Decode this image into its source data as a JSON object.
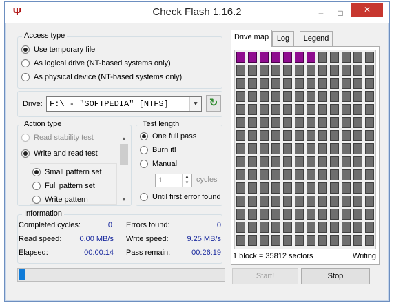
{
  "window": {
    "title": "Check Flash 1.16.2",
    "icon": "usb-plug-icon",
    "controls": {
      "minimize": "–",
      "maximize": "□",
      "close": "✕"
    }
  },
  "access_type": {
    "title": "Access type",
    "options": [
      {
        "label": "Use temporary file",
        "checked": true
      },
      {
        "label": "As logical drive (NT-based systems only)",
        "checked": false
      },
      {
        "label": "As physical device (NT-based systems only)",
        "checked": false
      }
    ]
  },
  "drive": {
    "label": "Drive:",
    "value": "F:\\ - \"SOFTPEDIA\" [NTFS]"
  },
  "action_type": {
    "title": "Action type",
    "options": [
      {
        "label": "Read stability test",
        "checked": false,
        "enabled": false
      },
      {
        "label": "Write and read test",
        "checked": true,
        "enabled": true
      }
    ],
    "sub_options": [
      {
        "label": "Small pattern set",
        "checked": true
      },
      {
        "label": "Full pattern set",
        "checked": false
      },
      {
        "label": "Write pattern",
        "checked": false
      }
    ]
  },
  "test_length": {
    "title": "Test length",
    "options": [
      {
        "label": "One full pass",
        "checked": true
      },
      {
        "label": "Burn it!",
        "checked": false
      },
      {
        "label": "Manual",
        "checked": false
      },
      {
        "label": "Until first error found",
        "checked": false
      }
    ],
    "cycles_value": "1",
    "cycles_label": "cycles"
  },
  "information": {
    "title": "Information",
    "completed_cycles_label": "Completed cycles:",
    "completed_cycles": "0",
    "errors_found_label": "Errors found:",
    "errors_found": "0",
    "read_speed_label": "Read speed:",
    "read_speed": "0.00 MB/s",
    "write_speed_label": "Write speed:",
    "write_speed": "9.25 MB/s",
    "elapsed_label": "Elapsed:",
    "elapsed": "00:00:14",
    "pass_remain_label": "Pass remain:",
    "pass_remain": "00:26:19"
  },
  "progress": {
    "fraction": 0.03
  },
  "tabs": [
    {
      "label": "Drive map",
      "active": true
    },
    {
      "label": "Log",
      "active": false
    },
    {
      "label": "Legend",
      "active": false
    }
  ],
  "drive_map": {
    "columns": 12,
    "rows": 15,
    "used_blocks": 7,
    "used_color": "#8e0c8e",
    "free_color": "#6e6e6e",
    "block_info": "1 block = 35812 sectors",
    "status": "Writing"
  },
  "buttons": {
    "start": "Start!",
    "stop": "Stop"
  },
  "colors": {
    "value_text": "#1a2a9e",
    "progress": "#0f7bd8",
    "close_button": "#c7372f"
  }
}
